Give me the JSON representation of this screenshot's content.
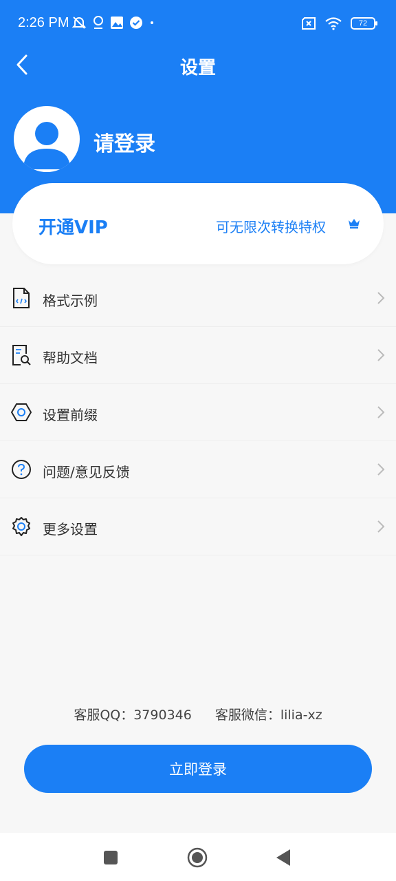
{
  "status_bar": {
    "time": "2:26 PM",
    "battery": "72",
    "icons": [
      "mute-bell-icon",
      "location-pin-icon",
      "image-icon",
      "check-circle-icon",
      "dot-icon",
      "no-sim-icon",
      "wifi-icon",
      "battery-icon"
    ]
  },
  "header": {
    "title": "设置",
    "back_icon": "chevron-left-icon"
  },
  "profile": {
    "avatar_icon": "user-avatar-icon",
    "login_prompt": "请登录"
  },
  "vip": {
    "title": "开通VIP",
    "description": "可无限次转换特权",
    "icon": "crown-icon"
  },
  "menu": {
    "items": [
      {
        "label": "格式示例",
        "icon": "code-file-icon"
      },
      {
        "label": "帮助文档",
        "icon": "search-document-icon"
      },
      {
        "label": "设置前缀",
        "icon": "hexagon-nut-icon"
      },
      {
        "label": "问题/意见反馈",
        "icon": "question-circle-icon"
      },
      {
        "label": "更多设置",
        "icon": "gear-icon"
      }
    ]
  },
  "footer": {
    "qq": "客服QQ：3790346",
    "wechat": "客服微信：lilia-xz",
    "login_button": "立即登录"
  },
  "colors": {
    "primary": "#1b7ff5",
    "background": "#f7f7f7",
    "text": "#333333"
  }
}
